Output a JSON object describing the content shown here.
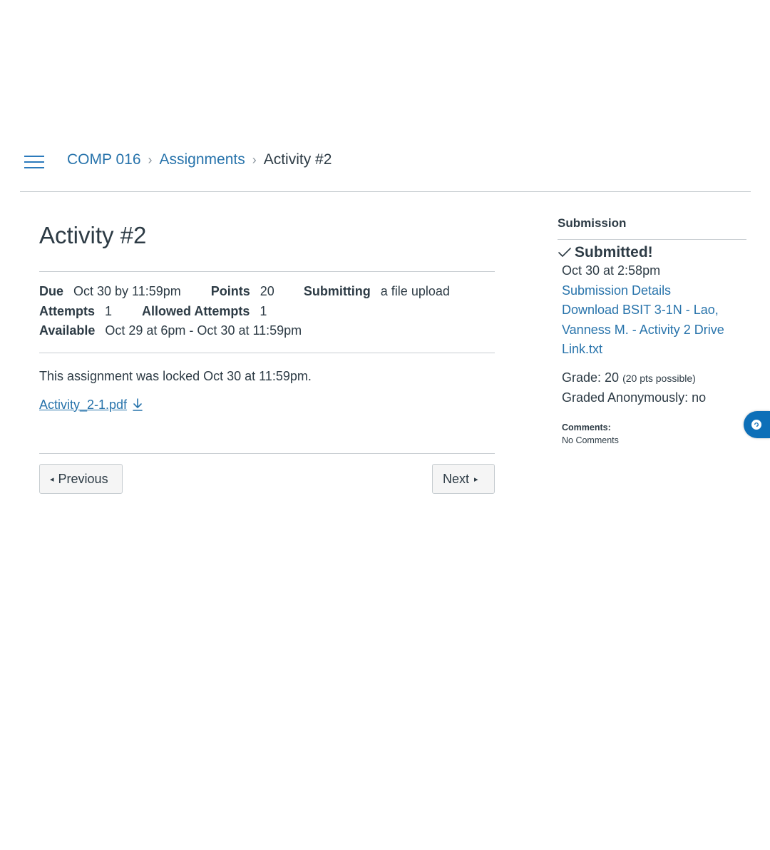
{
  "breadcrumb": {
    "course": "COMP 016",
    "section": "Assignments",
    "current": "Activity #2"
  },
  "assignment": {
    "title": "Activity #2",
    "due_label": "Due",
    "due_value": "Oct 30 by 11:59pm",
    "points_label": "Points",
    "points_value": "20",
    "submitting_label": "Submitting",
    "submitting_value": "a file upload",
    "attempts_label": "Attempts",
    "attempts_value": "1",
    "allowed_label": "Allowed Attempts",
    "allowed_value": "1",
    "available_label": "Available",
    "available_value": "Oct 29 at 6pm - Oct 30 at 11:59pm",
    "locked_text": "This assignment was locked Oct 30 at 11:59pm.",
    "attachment": "Activity_2-1.pdf"
  },
  "pager": {
    "previous": "Previous",
    "next": "Next"
  },
  "submission": {
    "heading": "Submission",
    "status": "Submitted!",
    "time": "Oct 30 at 2:58pm",
    "details_link": "Submission Details",
    "download_link": "Download BSIT 3-1N - Lao, Vanness M. - Activity 2 Drive Link.txt",
    "grade_label": "Grade: 20",
    "grade_possible": "(20 pts possible)",
    "anonymous": "Graded Anonymously: no",
    "comments_label": "Comments:",
    "comments_value": "No Comments"
  },
  "colors": {
    "link": "#2773ab",
    "text": "#2d3b45",
    "border": "#c7cdd1",
    "widget": "#0d6fb8"
  }
}
